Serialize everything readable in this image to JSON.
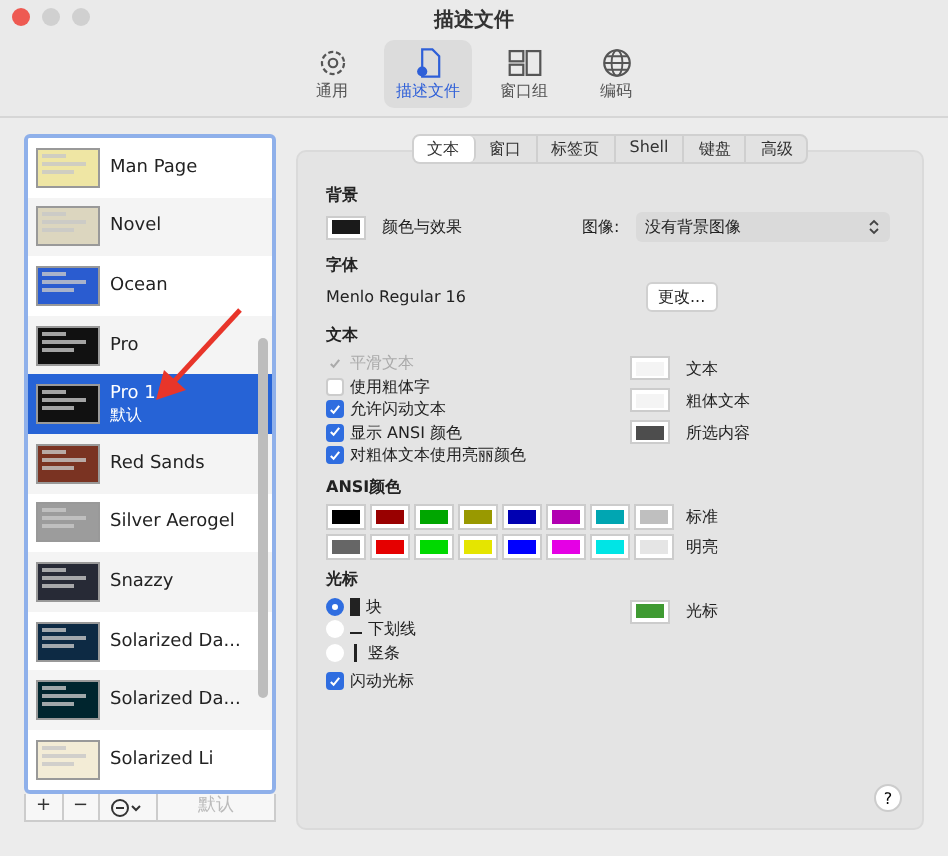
{
  "window": {
    "title": "描述文件"
  },
  "toolbar": [
    {
      "label": "通用",
      "kind": "gear",
      "selected": false
    },
    {
      "label": "描述文件",
      "kind": "profile",
      "selected": true
    },
    {
      "label": "窗口组",
      "kind": "windows",
      "selected": false
    },
    {
      "label": "编码",
      "kind": "globe",
      "selected": false
    }
  ],
  "profiles": [
    {
      "name": "Man Page",
      "color": "#efe6a4",
      "selected": false
    },
    {
      "name": "Novel",
      "color": "#dcd6bf",
      "selected": false
    },
    {
      "name": "Ocean",
      "color": "#2a5cd0",
      "selected": false
    },
    {
      "name": "Pro",
      "color": "#111111",
      "selected": false
    },
    {
      "name": "Pro 1",
      "subtitle": "默认",
      "color": "#111111",
      "selected": true
    },
    {
      "name": "Red Sands",
      "color": "#7a3322",
      "selected": false
    },
    {
      "name": "Silver Aerogel",
      "color": "#9c9c9c",
      "selected": false
    },
    {
      "name": "Snazzy",
      "color": "#272a36",
      "selected": false
    },
    {
      "name": "Solarized Da...",
      "color": "#0d2a44",
      "selected": false
    },
    {
      "name": "Solarized Da...",
      "color": "#00252e",
      "selected": false
    },
    {
      "name": "Solarized Li",
      "color": "#f3ecd6",
      "selected": false
    }
  ],
  "list_buttons": [
    {
      "kind": "add",
      "label": "+"
    },
    {
      "kind": "remove",
      "label": "−"
    },
    {
      "kind": "menu"
    },
    {
      "kind": "default",
      "label": "默认",
      "disabled": true
    }
  ],
  "tabs": [
    {
      "label": "文本",
      "selected": true
    },
    {
      "label": "窗口",
      "selected": false
    },
    {
      "label": "标签页",
      "selected": false
    },
    {
      "label": "Shell",
      "selected": false
    },
    {
      "label": "键盘",
      "selected": false
    },
    {
      "label": "高级",
      "selected": false
    }
  ],
  "background": {
    "heading": "背景",
    "color": "#1a1a1a",
    "color_label": "颜色与效果",
    "image_label": "图像:",
    "image_value": "没有背景图像"
  },
  "font": {
    "heading": "字体",
    "value": "Menlo Regular 16",
    "button": "更改..."
  },
  "text": {
    "heading": "文本",
    "options": [
      {
        "label": "平滑文本",
        "checked": true,
        "disabled": true
      },
      {
        "label": "使用粗体字",
        "checked": false,
        "disabled": false
      },
      {
        "label": "允许闪动文本",
        "checked": true,
        "disabled": false
      },
      {
        "label": "显示 ANSI 颜色",
        "checked": true,
        "disabled": false
      },
      {
        "label": "对粗体文本使用亮丽颜色",
        "checked": true,
        "disabled": false
      }
    ],
    "colors": [
      {
        "label": "文本",
        "color": "#f4f4f4"
      },
      {
        "label": "粗体文本",
        "color": "#f4f4f4"
      },
      {
        "label": "所选内容",
        "color": "#4d4d4d"
      }
    ]
  },
  "ansi": {
    "heading": "ANSI颜色",
    "rows": [
      {
        "label": "标准",
        "swatches": [
          {
            "color": "#000000"
          },
          {
            "color": "#990000"
          },
          {
            "color": "#00a600"
          },
          {
            "color": "#999900"
          },
          {
            "color": "#0000b2"
          },
          {
            "color": "#b200b2"
          },
          {
            "color": "#00a6b2"
          },
          {
            "color": "#bfbfbf"
          }
        ]
      },
      {
        "label": "明亮",
        "swatches": [
          {
            "color": "#666666"
          },
          {
            "color": "#e50000"
          },
          {
            "color": "#00d900"
          },
          {
            "color": "#e5e500"
          },
          {
            "color": "#0000ff"
          },
          {
            "color": "#e500e5"
          },
          {
            "color": "#00e5e5"
          },
          {
            "color": "#e5e5e5"
          }
        ]
      }
    ]
  },
  "cursor": {
    "heading": "光标",
    "styles": [
      {
        "kind": "block",
        "label": "块",
        "selected": true
      },
      {
        "kind": "underline",
        "label": "下划线",
        "selected": false
      },
      {
        "kind": "bar",
        "label": "竖条",
        "selected": false
      }
    ],
    "color": {
      "label": "光标",
      "color": "#3f9a32"
    },
    "blink": {
      "label": "闪动光标",
      "checked": true
    }
  },
  "help": "?"
}
